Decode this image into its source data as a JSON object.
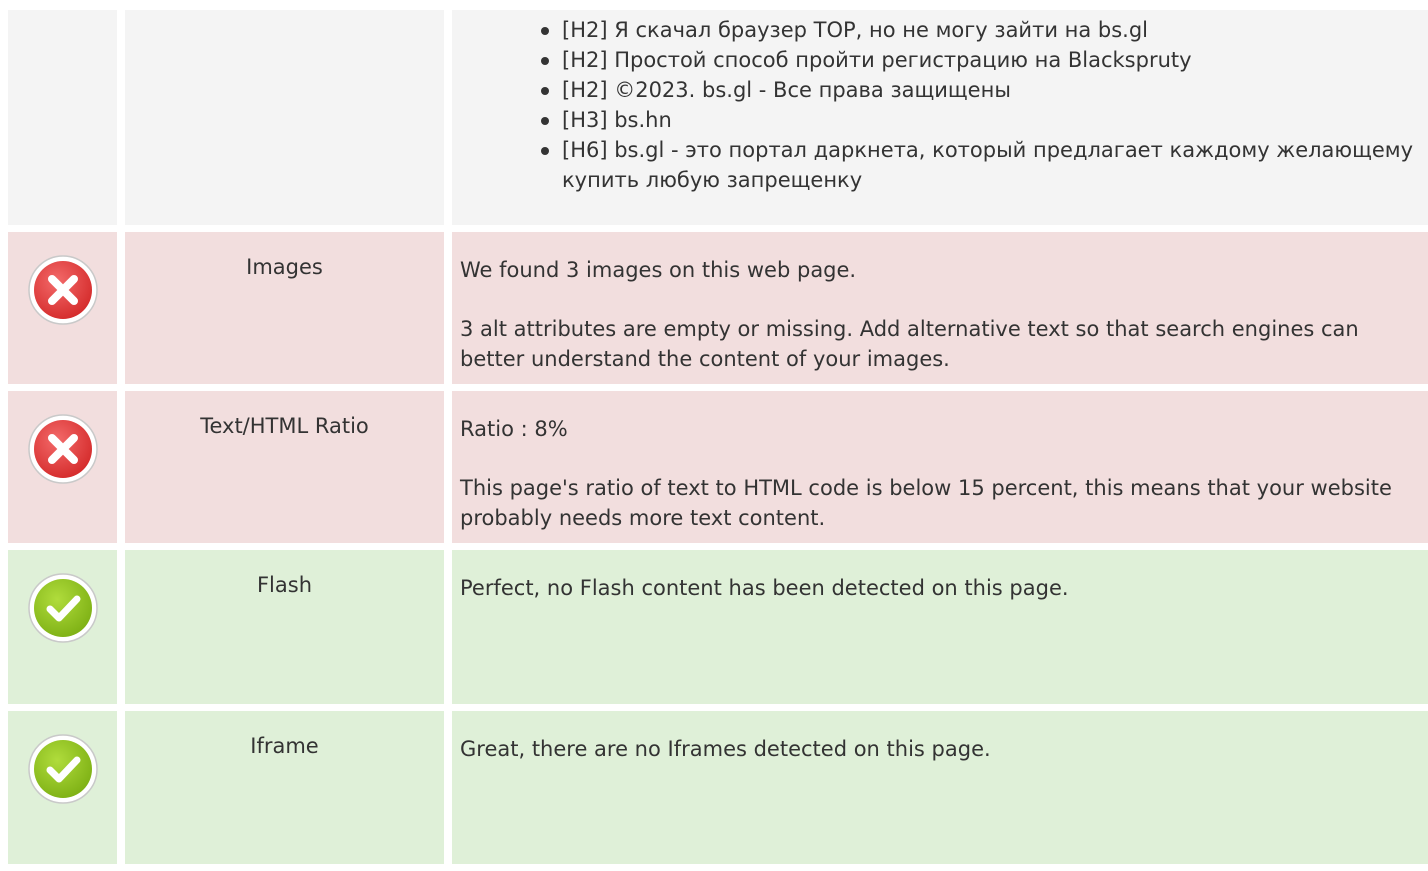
{
  "headings_list": [
    "[H2] Я скачал браузер TOP, но не могу зайти на bs.gl",
    "[H2] Простой способ пройти регистрацию на Blackspruty",
    "[H2] ©2023. bs.gl - Все права защищены",
    "[H3] bs.hn",
    "[H6] bs.gl - это портал даркнета, который предлагает каждому желающему купить любую запрещенку"
  ],
  "rows": [
    {
      "status": "error",
      "icon": "error-x-icon",
      "label": "Images",
      "paragraphs": [
        "We found 3 images on this web page.",
        "3 alt attributes are empty or missing. Add alternative text so that search engines can better understand the content of your images."
      ]
    },
    {
      "status": "error",
      "icon": "error-x-icon",
      "label": "Text/HTML Ratio",
      "paragraphs": [
        "Ratio : 8%",
        "This page's ratio of text to HTML code is below 15 percent, this means that your website probably needs more text content."
      ]
    },
    {
      "status": "success",
      "icon": "success-check-icon",
      "label": "Flash",
      "paragraphs": [
        "Perfect, no Flash content has been detected on this page."
      ]
    },
    {
      "status": "success",
      "icon": "success-check-icon",
      "label": "Iframe",
      "paragraphs": [
        "Great, there are no Iframes detected on this page."
      ]
    }
  ],
  "colors": {
    "neutral_bg": "#f4f4f4",
    "error_bg": "#f2dede",
    "success_bg": "#dff0d8",
    "error_icon": "#e63a3a",
    "success_icon": "#8fc31f",
    "text": "#333333"
  }
}
